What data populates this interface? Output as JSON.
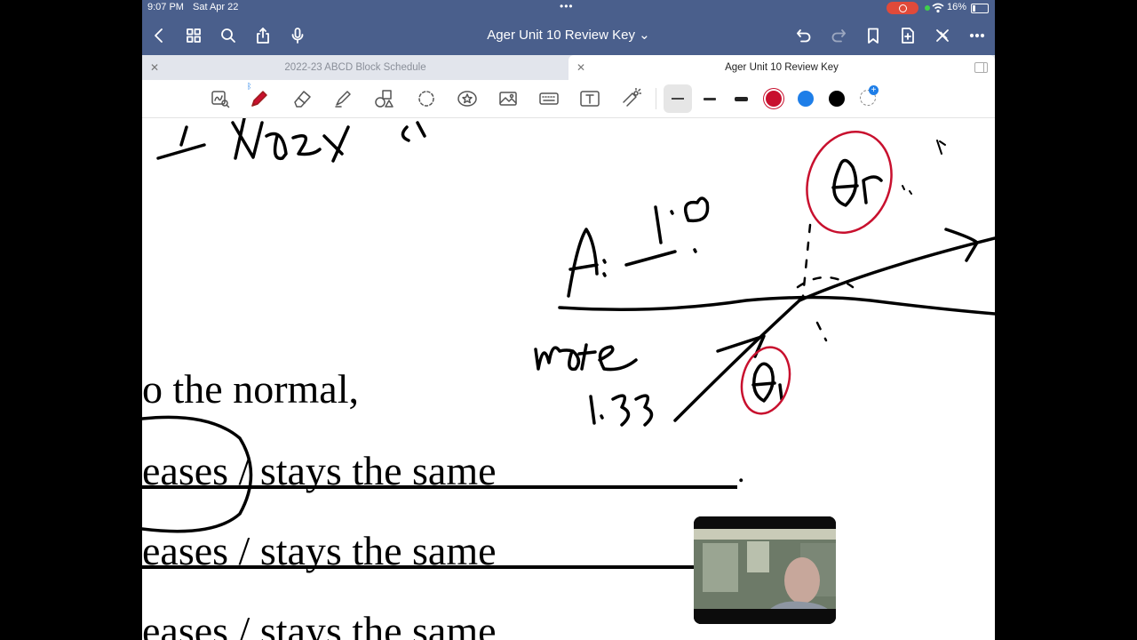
{
  "status": {
    "time": "9:07 PM",
    "date": "Sat Apr 22",
    "battery": "16%"
  },
  "nav": {
    "title": "Ager Unit 10 Review Key ⌄"
  },
  "tabs": [
    {
      "label": "2022-23 ABCD Block Schedule",
      "active": false
    },
    {
      "label": "Ager Unit 10 Review Key",
      "active": true
    }
  ],
  "toolbar": {
    "tools": [
      "lasso-ink-icon",
      "pen-icon",
      "eraser-icon",
      "highlighter-icon",
      "shapes-icon",
      "lasso-icon",
      "sticker-icon",
      "image-icon",
      "keyboard-icon",
      "text-icon",
      "laser-pointer-icon"
    ],
    "colors": [
      "#c8102e",
      "#1e7ee8",
      "#000000"
    ],
    "selected_color": "#c8102e"
  },
  "document": {
    "line1": "o the normal,",
    "line2": "eases  /  stays the same",
    "line3": "eases  /  stays the same",
    "line4": "eases  /  stays the same",
    "period": ".",
    "handwriting": {
      "index": "Index",
      "a_label": "A: 1.0",
      "water_label": "water",
      "water_value": "1.33",
      "theta_r": "θr",
      "theta_i": "θi"
    }
  },
  "colors": {
    "nav_bg": "#4a5f8c",
    "accent_red": "#c8102e",
    "recording": "#e04a3a"
  }
}
